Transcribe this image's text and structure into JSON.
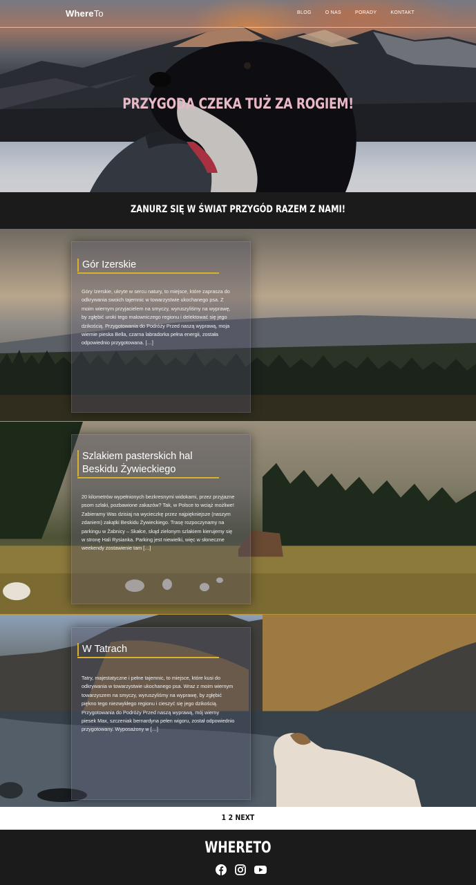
{
  "nav": {
    "logo_bold": "Where",
    "logo_rest": "To",
    "items": [
      "BLOG",
      "O NAS",
      "PORADY",
      "KONTAKT"
    ]
  },
  "hero": {
    "title": "PRZYGODA CZEKA TUŻ ZA ROGIEM!"
  },
  "tagline": "ZANURZ SIĘ W ŚWIAT PRZYGÓD RAZEM Z NAMI!",
  "posts": [
    {
      "title": "Gór Izerskie",
      "excerpt": "Góry Izerskie, ukryte w sercu natury, to miejsce, które zaprasza do odkrywania swoich tajemnic w towarzystwie ukochanego psa. Z moim wiernym przyjacielem na smyczy, wyruszyliśmy na wyprawę, by zgłębić uroki tego malowniczego regionu i delektować się jego dzikością. Przygotowania do Podróży Przed naszą wyprawą, moja wiernie pieska Bella, czarna labradorka pełna energii, została odpowiednio przygotowana. […]"
    },
    {
      "title": "Szlakiem pasterskich hal Beskidu Żywieckiego",
      "excerpt": "20 kilometrów wypełnionych bezkresnymi widokami, przez przyjazne psom szlaki, pozbawione zakazów? Tak, w Polsce to wciąż możliwe! Zabieramy Was dzisiaj na wycieczkę przez najpiękniejsze (naszym zdaniem) zakątki Beskidu Żywieckiego. Trasę rozpoczynamy na parkingu w Żabnicy – Skałce, skąd zielonym szlakiem kierujemy się w stronę Hali Rysianka. Parking jest niewielki, więc w słoneczne weekendy zostawienie tam […]"
    },
    {
      "title": "W Tatrach",
      "excerpt": "Tatry, majestatyczne i pełne tajemnic, to miejsce, które kusi do odkrywania w towarzystwie ukochanego psa. Wraz z moim wiernym towarzyszem na smyczy, wyruszyliśmy na wyprawę, by zgłębić piękno tego niezwykłego regionu i cieszyć się jego dzikością. Przygotowania do Podróży Przed naszą wyprawą, mój wierny piesek Max, szczeniak bernardyna pełen wigoru, został odpowiednio przygotowany. Wyposażony w […]"
    }
  ],
  "pagination": {
    "page1": "1",
    "page2": "2",
    "next": "NEXT"
  },
  "footer": {
    "logo": "WHERETO",
    "socials": [
      "facebook-icon",
      "instagram-icon",
      "youtube-icon"
    ]
  },
  "colors": {
    "accent": "#d9b32a",
    "dark": "#1b1b1b",
    "hero_title": "#e8b9c5"
  }
}
